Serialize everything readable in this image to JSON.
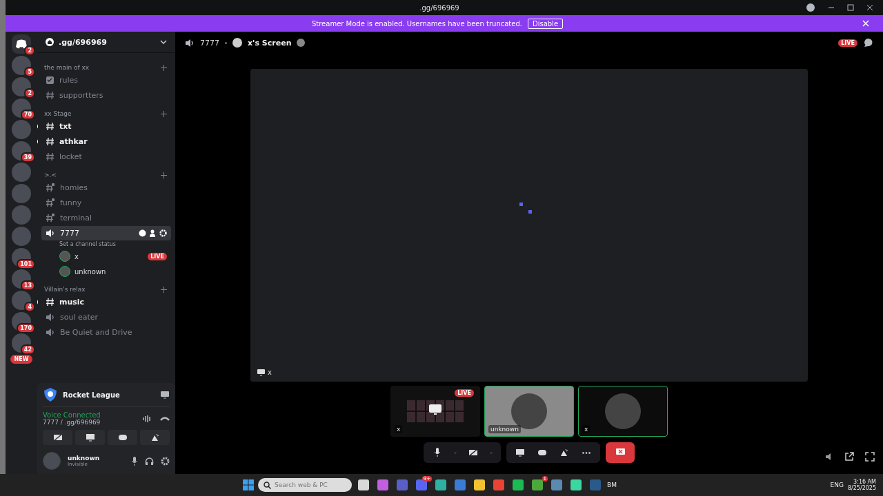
{
  "window": {
    "title": ".gg/696969"
  },
  "banner": {
    "text": "Streamer Mode is enabled. Usernames have been truncated.",
    "button": "Disable"
  },
  "servers": [
    {
      "kind": "home",
      "badge": "2"
    },
    {
      "kind": "server",
      "badge": "5"
    },
    {
      "kind": "server",
      "badge": "2"
    },
    {
      "kind": "server",
      "badge": "70"
    },
    {
      "kind": "server"
    },
    {
      "kind": "server",
      "badge": "39"
    },
    {
      "kind": "server"
    },
    {
      "kind": "server"
    },
    {
      "kind": "server"
    },
    {
      "kind": "server"
    },
    {
      "kind": "server",
      "badge": "101"
    },
    {
      "kind": "server",
      "badge": "13"
    },
    {
      "kind": "server",
      "badge": "4"
    },
    {
      "kind": "server",
      "badge": "170"
    },
    {
      "kind": "server",
      "badge": "42"
    }
  ],
  "new_badge": "NEW",
  "sidebar": {
    "server_name": ".gg/696969",
    "categories": [
      {
        "name": "the main of xx",
        "channels": [
          {
            "name": "rules",
            "kind": "rules",
            "unread": false,
            "selected": false
          },
          {
            "name": "supportters",
            "kind": "text",
            "unread": false,
            "selected": false
          }
        ]
      },
      {
        "name": "xx Stage",
        "channels": [
          {
            "name": "txt",
            "kind": "text",
            "unread": true,
            "selected": false
          },
          {
            "name": "athkar",
            "kind": "text",
            "unread": true,
            "selected": false
          },
          {
            "name": "locket",
            "kind": "text",
            "unread": false,
            "selected": false
          }
        ]
      },
      {
        "name": ">.<",
        "channels": [
          {
            "name": "homies",
            "kind": "locked",
            "unread": false,
            "selected": false
          },
          {
            "name": "funny",
            "kind": "locked",
            "unread": false,
            "selected": false
          },
          {
            "name": "terminal",
            "kind": "locked",
            "unread": false,
            "selected": false
          },
          {
            "name": "7777",
            "kind": "voice",
            "unread": false,
            "selected": true,
            "status": "Set a channel status",
            "members": [
              {
                "name": "x",
                "badge": "LIVE"
              },
              {
                "name": "unknown"
              }
            ]
          }
        ]
      },
      {
        "name": "Villain's relax",
        "channels": [
          {
            "name": "music",
            "kind": "text",
            "unread": true,
            "selected": false
          },
          {
            "name": "soul eater",
            "kind": "voice",
            "unread": false,
            "selected": false
          },
          {
            "name": "Be Quiet and Drive",
            "kind": "voice",
            "unread": false,
            "selected": false
          }
        ]
      }
    ]
  },
  "activity": {
    "game": "Rocket League"
  },
  "voice": {
    "status": "Voice Connected",
    "location": "7777 / .gg/696969"
  },
  "user": {
    "name": "unknown",
    "status": "Invisible"
  },
  "header": {
    "channel": "7777",
    "stream": "x's Screen",
    "badge": "LIVE"
  },
  "stage": {
    "label": "x"
  },
  "tiles": [
    {
      "kind": "screen",
      "label": "x",
      "badge": "LIVE",
      "speaking": false
    },
    {
      "kind": "user",
      "label": "unknown",
      "speaking": true
    },
    {
      "kind": "user",
      "label": "x",
      "speaking": true
    }
  ],
  "taskbar": {
    "search_placeholder": "Search web & PC",
    "apps": [
      {
        "color": "#d8d8d8"
      },
      {
        "color": "#c060e0"
      },
      {
        "color": "#5a5fc8"
      },
      {
        "color": "#5865f2",
        "badge": "9+"
      },
      {
        "color": "#2fb0a0"
      },
      {
        "color": "#3a7bd5"
      },
      {
        "color": "#f2c230"
      },
      {
        "color": "#e94335"
      },
      {
        "color": "#1db954"
      },
      {
        "color": "#4ca83a",
        "badge": "1"
      },
      {
        "color": "#5a8ab0"
      },
      {
        "color": "#3ed6a0"
      },
      {
        "color": "#2a5a8a"
      }
    ],
    "tray_label": "BM",
    "language": "ENG",
    "time": "3:16 AM",
    "date": "8/25/2025"
  }
}
